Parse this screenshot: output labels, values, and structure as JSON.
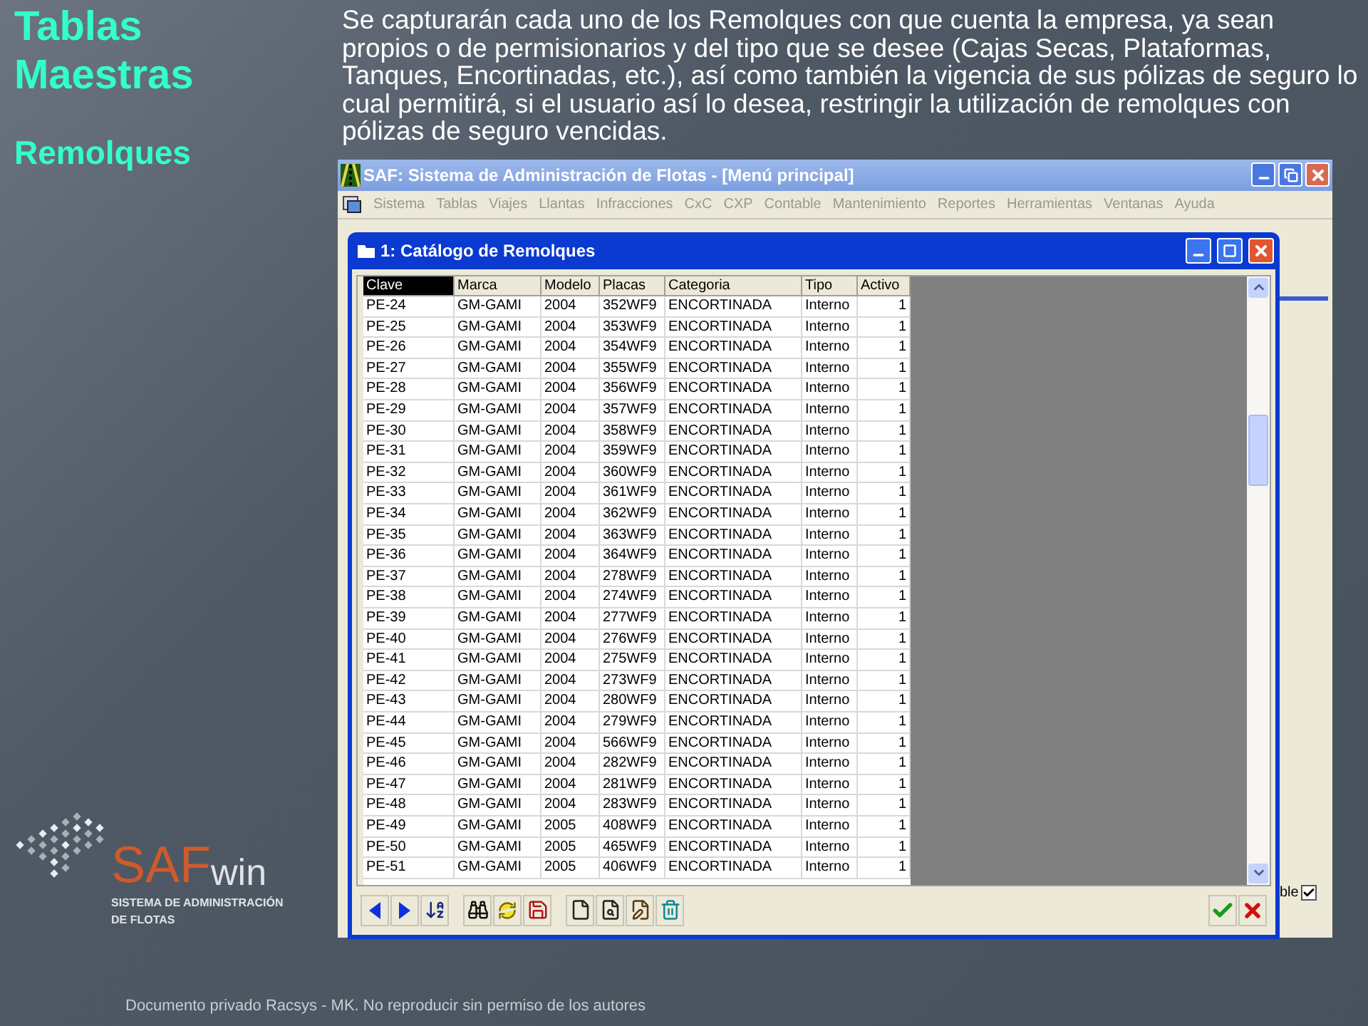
{
  "slide": {
    "title": "Tablas Maestras",
    "subtitle": "Remolques",
    "description": "Se capturarán cada uno de los Remolques con que cuenta la empresa, ya sean propios o de permisionarios y del tipo que se desee (Cajas Secas, Plataformas, Tanques, Encortinadas, etc.), así como también la vigencia de sus pólizas de seguro lo cual permitirá, si el usuario así lo desea, restringir la utilización de remolques con pólizas de seguro vencidas.",
    "footer": "Documento privado Racsys - MK. No reproducir sin permiso de los autores"
  },
  "logo": {
    "brand_main": "SAF",
    "brand_suffix": "win",
    "tagline_1": "SISTEMA DE ADMINISTRACIÓN",
    "tagline_2": "DE FLOTAS"
  },
  "window": {
    "title": "SAF: Sistema de Administración de Flotas - [Menú principal]"
  },
  "menu": [
    "Sistema",
    "Tablas",
    "Viajes",
    "Llantas",
    "Infracciones",
    "CxC",
    "CXP",
    "Contable",
    "Mantenimiento",
    "Reportes",
    "Herramientas",
    "Ventanas",
    "Ayuda"
  ],
  "side_panel": {
    "checkbox_label": "ble",
    "checked": true
  },
  "child_window": {
    "title": "1: Catálogo de Remolques"
  },
  "table": {
    "columns": [
      {
        "label": "Clave",
        "selected": true
      },
      {
        "label": "Marca",
        "selected": false
      },
      {
        "label": "Modelo",
        "selected": false
      },
      {
        "label": "Placas",
        "selected": false
      },
      {
        "label": "Categoria",
        "selected": false
      },
      {
        "label": "Tipo",
        "selected": false
      },
      {
        "label": "Activo",
        "selected": false
      }
    ],
    "rows": [
      [
        "PE-24",
        "GM-GAMI",
        "2004",
        "352WF9",
        "ENCORTINADA",
        "Interno",
        "1"
      ],
      [
        "PE-25",
        "GM-GAMI",
        "2004",
        "353WF9",
        "ENCORTINADA",
        "Interno",
        "1"
      ],
      [
        "PE-26",
        "GM-GAMI",
        "2004",
        "354WF9",
        "ENCORTINADA",
        "Interno",
        "1"
      ],
      [
        "PE-27",
        "GM-GAMI",
        "2004",
        "355WF9",
        "ENCORTINADA",
        "Interno",
        "1"
      ],
      [
        "PE-28",
        "GM-GAMI",
        "2004",
        "356WF9",
        "ENCORTINADA",
        "Interno",
        "1"
      ],
      [
        "PE-29",
        "GM-GAMI",
        "2004",
        "357WF9",
        "ENCORTINADA",
        "Interno",
        "1"
      ],
      [
        "PE-30",
        "GM-GAMI",
        "2004",
        "358WF9",
        "ENCORTINADA",
        "Interno",
        "1"
      ],
      [
        "PE-31",
        "GM-GAMI",
        "2004",
        "359WF9",
        "ENCORTINADA",
        "Interno",
        "1"
      ],
      [
        "PE-32",
        "GM-GAMI",
        "2004",
        "360WF9",
        "ENCORTINADA",
        "Interno",
        "1"
      ],
      [
        "PE-33",
        "GM-GAMI",
        "2004",
        "361WF9",
        "ENCORTINADA",
        "Interno",
        "1"
      ],
      [
        "PE-34",
        "GM-GAMI",
        "2004",
        "362WF9",
        "ENCORTINADA",
        "Interno",
        "1"
      ],
      [
        "PE-35",
        "GM-GAMI",
        "2004",
        "363WF9",
        "ENCORTINADA",
        "Interno",
        "1"
      ],
      [
        "PE-36",
        "GM-GAMI",
        "2004",
        "364WF9",
        "ENCORTINADA",
        "Interno",
        "1"
      ],
      [
        "PE-37",
        "GM-GAMI",
        "2004",
        "278WF9",
        "ENCORTINADA",
        "Interno",
        "1"
      ],
      [
        "PE-38",
        "GM-GAMI",
        "2004",
        "274WF9",
        "ENCORTINADA",
        "Interno",
        "1"
      ],
      [
        "PE-39",
        "GM-GAMI",
        "2004",
        "277WF9",
        "ENCORTINADA",
        "Interno",
        "1"
      ],
      [
        "PE-40",
        "GM-GAMI",
        "2004",
        "276WF9",
        "ENCORTINADA",
        "Interno",
        "1"
      ],
      [
        "PE-41",
        "GM-GAMI",
        "2004",
        "275WF9",
        "ENCORTINADA",
        "Interno",
        "1"
      ],
      [
        "PE-42",
        "GM-GAMI",
        "2004",
        "273WF9",
        "ENCORTINADA",
        "Interno",
        "1"
      ],
      [
        "PE-43",
        "GM-GAMI",
        "2004",
        "280WF9",
        "ENCORTINADA",
        "Interno",
        "1"
      ],
      [
        "PE-44",
        "GM-GAMI",
        "2004",
        "279WF9",
        "ENCORTINADA",
        "Interno",
        "1"
      ],
      [
        "PE-45",
        "GM-GAMI",
        "2004",
        "566WF9",
        "ENCORTINADA",
        "Interno",
        "1"
      ],
      [
        "PE-46",
        "GM-GAMI",
        "2004",
        "282WF9",
        "ENCORTINADA",
        "Interno",
        "1"
      ],
      [
        "PE-47",
        "GM-GAMI",
        "2004",
        "281WF9",
        "ENCORTINADA",
        "Interno",
        "1"
      ],
      [
        "PE-48",
        "GM-GAMI",
        "2004",
        "283WF9",
        "ENCORTINADA",
        "Interno",
        "1"
      ],
      [
        "PE-49",
        "GM-GAMI",
        "2005",
        "408WF9",
        "ENCORTINADA",
        "Interno",
        "1"
      ],
      [
        "PE-50",
        "GM-GAMI",
        "2005",
        "465WF9",
        "ENCORTINADA",
        "Interno",
        "1"
      ],
      [
        "PE-51",
        "GM-GAMI",
        "2005",
        "406WF9",
        "ENCORTINADA",
        "Interno",
        "1"
      ]
    ]
  }
}
